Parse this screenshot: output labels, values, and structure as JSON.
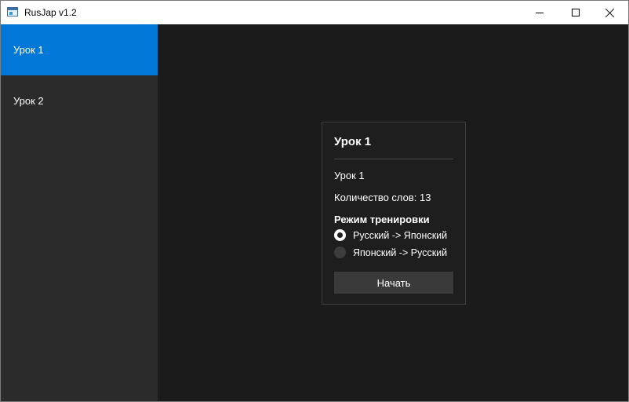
{
  "window": {
    "title": "RusJap v1.2",
    "icon": "app-window-icon",
    "controls": [
      "minimize-icon",
      "maximize-icon",
      "close-icon"
    ]
  },
  "sidebar": {
    "items": [
      {
        "label": "Урок 1",
        "active": true
      },
      {
        "label": "Урок 2",
        "active": false
      }
    ]
  },
  "lesson_card": {
    "title": "Урок 1",
    "description": "Урок 1",
    "word_count_text": "Количество слов: 13",
    "mode_heading": "Режим тренировки",
    "modes": [
      {
        "label": "Русский -> Японский",
        "checked": true
      },
      {
        "label": "Японский -> Русский",
        "checked": false
      }
    ],
    "start_label": "Начать"
  },
  "colors": {
    "accent": "#0078d7",
    "sidebar_bg": "#2b2b2b",
    "main_bg": "#1b1b1b",
    "button_bg": "#3a3a3a"
  }
}
